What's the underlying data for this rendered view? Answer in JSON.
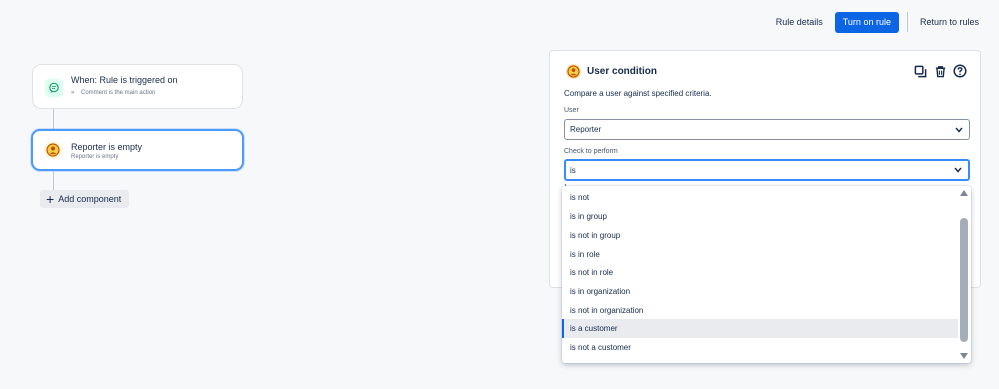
{
  "topbar": {
    "rule_details": "Rule details",
    "turn_on": "Turn on rule",
    "return": "Return to rules"
  },
  "flow": {
    "trigger": {
      "title": "When: Rule is triggered on",
      "subtitle": "Comment is the main action",
      "icon": "comment-icon"
    },
    "condition": {
      "title": "Reporter is empty",
      "subtitle": "Reporter is empty",
      "icon": "user-icon"
    },
    "add_component": "Add component"
  },
  "panel": {
    "title": "User condition",
    "description": "Compare a user against specified criteria.",
    "user_label": "User",
    "user_value": "Reporter",
    "check_label": "Check to perform",
    "check_value": "is",
    "actions": [
      "copy-icon",
      "trash-icon",
      "help-icon"
    ]
  },
  "dropdown": {
    "options": [
      "is not",
      "is in group",
      "is not in group",
      "is in role",
      "is not in role",
      "is in organization",
      "is not in organization",
      "is a customer",
      "is not a customer"
    ],
    "highlighted_index": 7
  },
  "colors": {
    "primary": "#0c66e4",
    "focus": "#388bff",
    "trigger_bg": "#dcfff1",
    "condition_bg": "#fff7d6"
  }
}
